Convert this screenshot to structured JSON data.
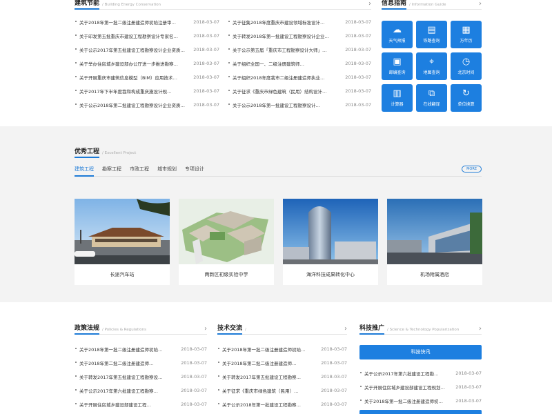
{
  "top": {
    "building": {
      "title": "建筑节能",
      "title_en": "/ Building Energy Conservation",
      "left_items": [
        {
          "title": "关于2018年第一批二级注册建造师初始注册审…",
          "date": "2018-03-07"
        },
        {
          "title": "关于印发第五批重庆市建设工程勘察设计专家名…",
          "date": "2018-03-07"
        },
        {
          "title": "关于公示2017年第五批建设工程勘察设计企业资质…",
          "date": "2018-03-07"
        },
        {
          "title": "关于举办住房城乡建设部办公厅进一步推进勘察…",
          "date": "2018-03-07"
        },
        {
          "title": "关于开展重庆市建筑信息模型（BIM）应用技术…",
          "date": "2018-03-07"
        },
        {
          "title": "关于2017年下半年度我和构成重庆施设计规…",
          "date": "2018-03-07"
        },
        {
          "title": "关于公示2018年第二批建设工程勘察设计企业资质…",
          "date": "2018-03-07"
        }
      ],
      "right_items": [
        {
          "title": "关于征集2018年度重庆市建设领域标准设计…",
          "date": "2018-03-07"
        },
        {
          "title": "关于转发2018年第一批建设工程勘察设计企业…",
          "date": "2018-03-07"
        },
        {
          "title": "关于公示第五届「重庆市工程勘察设计大师」…",
          "date": "2018-03-07"
        },
        {
          "title": "关于组织全国一、二级注册建筑师…",
          "date": "2018-03-07"
        },
        {
          "title": "关于组织2018年度我市二级注册建造师执业…",
          "date": "2018-03-07"
        },
        {
          "title": "关于征求《重庆市绿色建筑（民用）结构设计…",
          "date": "2018-03-07"
        },
        {
          "title": "关于公示2018年第一批建设工程勘察设计…",
          "date": "2018-03-07"
        }
      ]
    },
    "info": {
      "title": "信息指南",
      "title_en": "/ Information Guide",
      "tiles": [
        {
          "label": "天气预报",
          "icon": "☁"
        },
        {
          "label": "铁路查询",
          "icon": "▤"
        },
        {
          "label": "万年历",
          "icon": "▦"
        },
        {
          "label": "邮编查询",
          "icon": "▣"
        },
        {
          "label": "地图查询",
          "icon": "⌖"
        },
        {
          "label": "北京时间",
          "icon": "◷"
        },
        {
          "label": "计算器",
          "icon": "▥"
        },
        {
          "label": "在线翻译",
          "icon": "⧉"
        },
        {
          "label": "单位换算",
          "icon": "↻"
        }
      ]
    }
  },
  "mid": {
    "title": "优秀工程",
    "title_en": "/ Excellent Project",
    "more": "MORE",
    "tabs": [
      "建筑工程",
      "勘察工程",
      "市政工程",
      "城市规划",
      "专项设计"
    ],
    "projects": [
      {
        "caption": "长途汽车站"
      },
      {
        "caption": "两新区初级实验中学"
      },
      {
        "caption": "海洋科技成果转化中心"
      },
      {
        "caption": "机场附属酒店"
      }
    ]
  },
  "bot": {
    "policy": {
      "title": "政策法规",
      "title_en": "/ Policies & Regulations",
      "items": [
        {
          "title": "关于2018年第一批二级注册建造师初始…",
          "date": "2018-03-07"
        },
        {
          "title": "关于2018年第二批二级注册建造师…",
          "date": "2018-03-07"
        },
        {
          "title": "关于转发2017年第五批建设工程勘察设…",
          "date": "2018-03-07"
        },
        {
          "title": "关于公示2017年第六批建设工程勘察…",
          "date": "2018-03-07"
        },
        {
          "title": "关于开展住房城乡建设部建设工程…",
          "date": "2018-03-07"
        }
      ]
    },
    "tech": {
      "title": "技术交流",
      "title_en": "/",
      "items": [
        {
          "title": "关于2018年第一批二级注册建造师初始…",
          "date": "2018-03-07"
        },
        {
          "title": "关于2018年第二批二级注册建造师…",
          "date": "2018-03-07"
        },
        {
          "title": "关于转发2017年第五批建设工程勘察…",
          "date": "2018-03-07"
        },
        {
          "title": "关于征求《重庆市绿色建筑（民用）…",
          "date": "2018-03-07"
        },
        {
          "title": "关于公示2018年第一批建设工程勘察…",
          "date": "2018-03-07"
        }
      ]
    },
    "science": {
      "title": "科技推广",
      "title_en": "/ Science & Technology Popularization",
      "button": "科技快讯",
      "items": [
        {
          "title": "关于公示2017年第六批建设工程勘…",
          "date": "2018-03-07"
        },
        {
          "title": "关于开展住房城乡建设部建设工程规划…",
          "date": "2018-03-07"
        },
        {
          "title": "关于2018年第一批二级注册建造师初…",
          "date": "2018-03-07"
        }
      ]
    }
  },
  "colors": {
    "accent": "#1d7fe0",
    "mid_bg": "#f3f3f3"
  }
}
